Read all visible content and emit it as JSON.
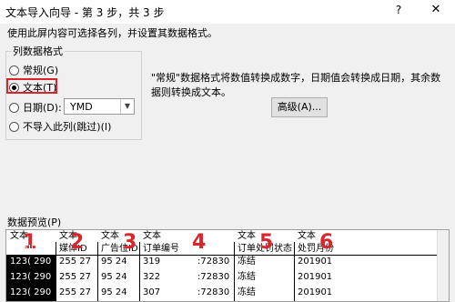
{
  "window": {
    "title": "文本导入向导 - 第 3 步，共 3 步",
    "help": "?",
    "close": "✕"
  },
  "instruction": "使用此屏内容可选择各列，并设置其数据格式。",
  "format_group": {
    "title": "列数据格式",
    "options": [
      {
        "label": "常规(G)",
        "checked": false
      },
      {
        "label": "文本(T)",
        "checked": true
      },
      {
        "label": "日期(D):",
        "checked": false
      },
      {
        "label": "不导入此列(跳过)(I)",
        "checked": false
      }
    ],
    "date_format": "YMD"
  },
  "description": "\"常规\"数据格式将数值转换成数字，日期值会转换成日期，其余数据则转换成文本。",
  "advanced_button": "高级(A)...",
  "preview": {
    "label": "数据预览(P)",
    "type_row": [
      "文本",
      "文本",
      "文本",
      "文本",
      "文本",
      "文本"
    ],
    "headers": [
      "会员ID",
      "媒体ID",
      "广告位ID",
      "订单编号",
      "订单处罚状态",
      "处罚月份"
    ],
    "rows": [
      [
        "123(  290",
        "255  27",
        "95  24",
        "319",
        ":72830",
        "冻结",
        "201901"
      ],
      [
        "123(  290",
        "255  27",
        "95  24",
        "322",
        ":72830",
        "冻结",
        "201901"
      ],
      [
        "123(  290",
        "255  27",
        "95  24",
        "307",
        ":72830",
        "冻结",
        "201901"
      ]
    ],
    "column_markers": [
      "1",
      "2",
      "3",
      "4",
      "5",
      "6"
    ]
  },
  "colors": {
    "accent_red": "#d9262d",
    "selected_column": "#000000"
  }
}
